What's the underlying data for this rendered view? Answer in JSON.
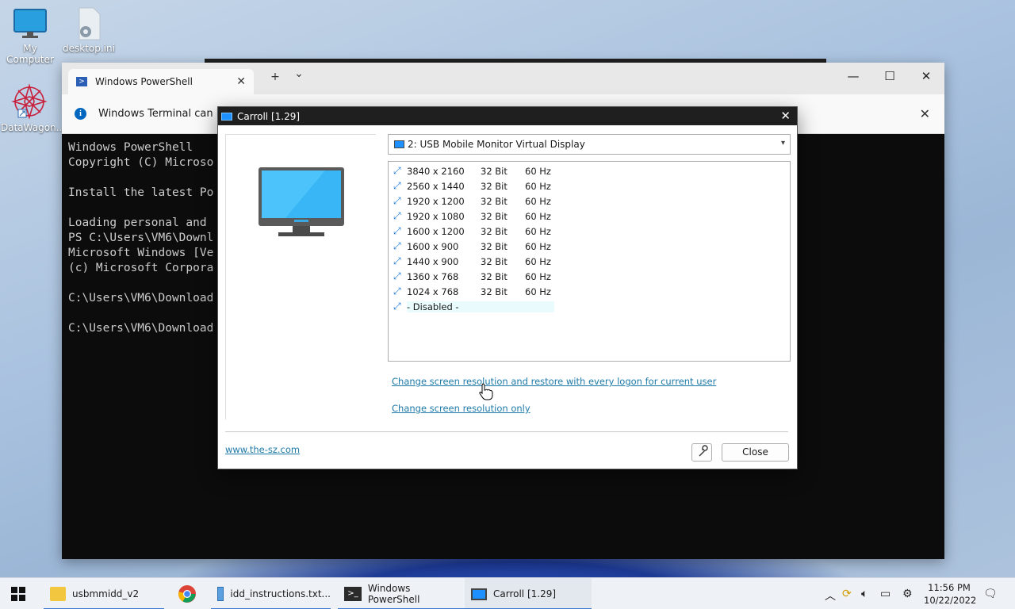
{
  "desktop": {
    "icons": [
      {
        "label": "My Computer"
      },
      {
        "label": "desktop.ini"
      },
      {
        "label": "DataWagon..."
      }
    ]
  },
  "terminal": {
    "tab_title": "Windows PowerShell",
    "new_tab": "+",
    "dropdown": "⌄",
    "info_text": "Windows Terminal can b",
    "console_lines": [
      "Windows PowerShell",
      "Copyright (C) Microso",
      "",
      "Install the latest Po",
      "",
      "Loading personal and ",
      "PS C:\\Users\\VM6\\Downl",
      "Microsoft Windows [Ve",
      "(c) Microsoft Corpora",
      "",
      "C:\\Users\\VM6\\Download",
      "",
      "C:\\Users\\VM6\\Download"
    ]
  },
  "dialog": {
    "title": "Carroll [1.29]",
    "display_selected": "2: USB Mobile Monitor Virtual Display",
    "resolutions": [
      {
        "res": "3840 x 2160",
        "bit": "32 Bit",
        "hz": "60 Hz"
      },
      {
        "res": "2560 x 1440",
        "bit": "32 Bit",
        "hz": "60 Hz"
      },
      {
        "res": "1920 x 1200",
        "bit": "32 Bit",
        "hz": "60 Hz"
      },
      {
        "res": "1920 x 1080",
        "bit": "32 Bit",
        "hz": "60 Hz"
      },
      {
        "res": "1600 x 1200",
        "bit": "32 Bit",
        "hz": "60 Hz"
      },
      {
        "res": "1600 x 900",
        "bit": "32 Bit",
        "hz": "60 Hz"
      },
      {
        "res": "1440 x 900",
        "bit": "32 Bit",
        "hz": "60 Hz"
      },
      {
        "res": "1360 x 768",
        "bit": "32 Bit",
        "hz": "60 Hz"
      },
      {
        "res": "1024 x 768",
        "bit": "32 Bit",
        "hz": "60 Hz"
      }
    ],
    "disabled_label": "- Disabled -",
    "link_restore": "Change screen resolution and restore with every logon for current user",
    "link_only": "Change screen resolution only",
    "site_link": "www.the-sz.com",
    "close_button": "Close"
  },
  "taskbar": {
    "items": [
      {
        "label": "usbmmidd_v2"
      },
      {
        "label": "idd_instructions.txt..."
      },
      {
        "label": "Windows PowerShell"
      },
      {
        "label": "Carroll [1.29]"
      }
    ],
    "time": "11:56 PM",
    "date": "10/22/2022"
  },
  "colors": {
    "accent": "#3a78d2",
    "link": "#1e7aa8",
    "console_bg": "#0c0c0c"
  }
}
